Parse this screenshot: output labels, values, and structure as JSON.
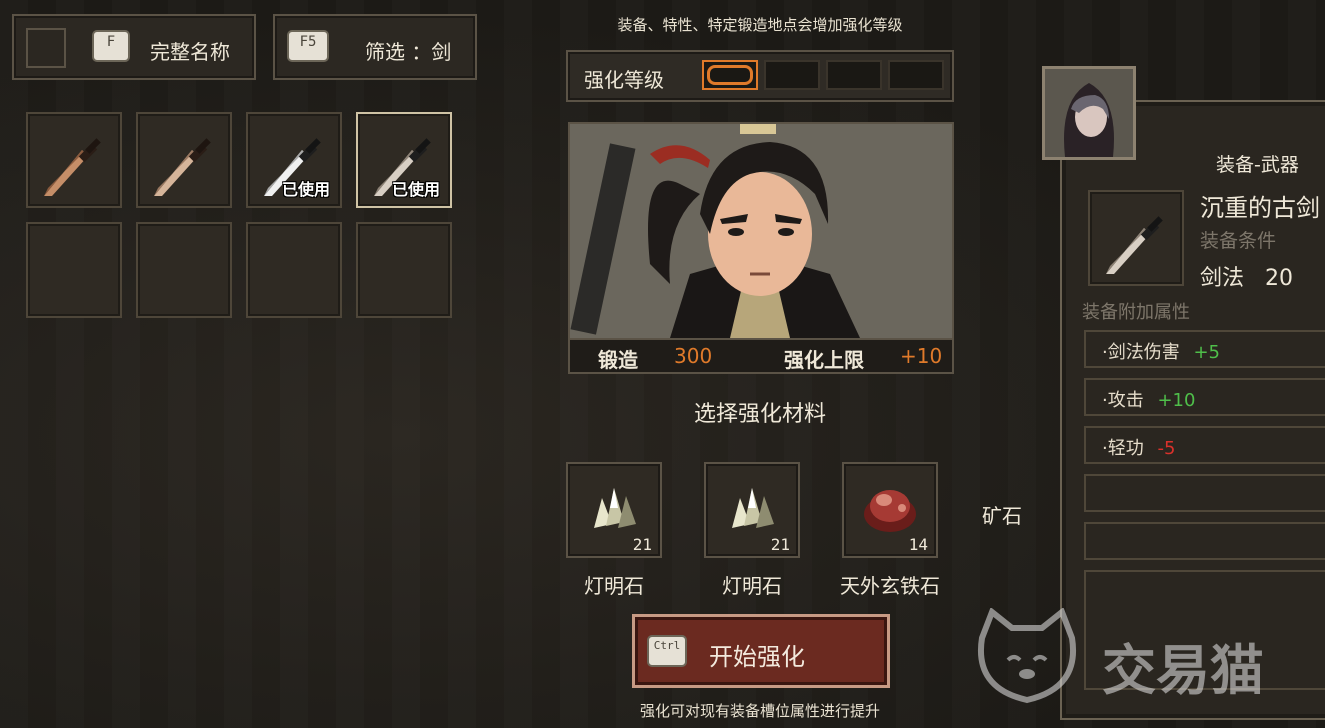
{
  "top_left": {
    "name_key": "F",
    "name_label": "完整名称",
    "filter_key": "F5",
    "filter_label": "筛选 ：剑"
  },
  "inventory": {
    "items": [
      {
        "icon": "dagger-icon",
        "used": false,
        "used_label": ""
      },
      {
        "icon": "dagger-icon",
        "used": false,
        "used_label": ""
      },
      {
        "icon": "sword-icon",
        "used": true,
        "used_label": "已使用"
      },
      {
        "icon": "sword-icon",
        "used": true,
        "used_label": "已使用",
        "selected": true
      }
    ]
  },
  "center": {
    "hint_top": "装备、特性、特定锻造地点会增加强化等级",
    "level_label": "强化等级",
    "level_filled": 1,
    "level_total": 4,
    "forge_label": "锻造",
    "forge_value": "300",
    "limit_label": "强化上限",
    "limit_value": "+10",
    "select_material": "选择强化材料",
    "ore_label": "矿石",
    "materials": [
      {
        "name": "灯明石",
        "count": "21",
        "icon": "crystal-icon"
      },
      {
        "name": "灯明石",
        "count": "21",
        "icon": "crystal-icon"
      },
      {
        "name": "天外玄铁石",
        "count": "14",
        "icon": "red-ore-icon"
      }
    ],
    "start_key": "Ctrl",
    "start_label": "开始强化",
    "hint_bottom": "强化可对现有装备槽位属性进行提升"
  },
  "right_panel": {
    "category": "装备-武器",
    "item_name": "沉重的古剑",
    "requirement_label": "装备条件",
    "skill_name": "剑法",
    "skill_value": "20",
    "attributes_label": "装备附加属性",
    "attributes": [
      {
        "name": "·剑法伤害",
        "value": "+5",
        "color": "#4fbf4a"
      },
      {
        "name": "·攻击",
        "value": "+10",
        "color": "#4fbf4a"
      },
      {
        "name": "·轻功",
        "value": "-5",
        "color": "#d9312b"
      }
    ]
  },
  "watermark": {
    "text": "交易猫"
  },
  "colors": {
    "accent_orange": "#e07a2a",
    "positive": "#4fbf4a",
    "negative": "#d9312b",
    "button_red": "#6b2a20"
  }
}
